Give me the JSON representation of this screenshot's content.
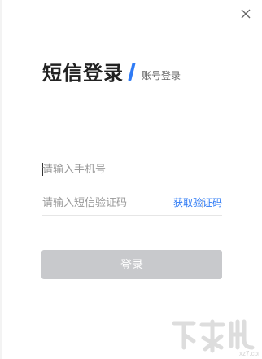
{
  "dialog": {
    "title": "短信登录",
    "alt_login_label": "账号登录",
    "accent_color": "#2f7bf5"
  },
  "form": {
    "phone_placeholder": "请输入手机号",
    "code_placeholder": "请输入短信验证码",
    "get_code_label": "获取验证码",
    "submit_label": "登录",
    "submit_color": "#c8c9cc"
  },
  "icons": {
    "close": "close-icon"
  },
  "watermark": {
    "brand": "xz7.com"
  }
}
